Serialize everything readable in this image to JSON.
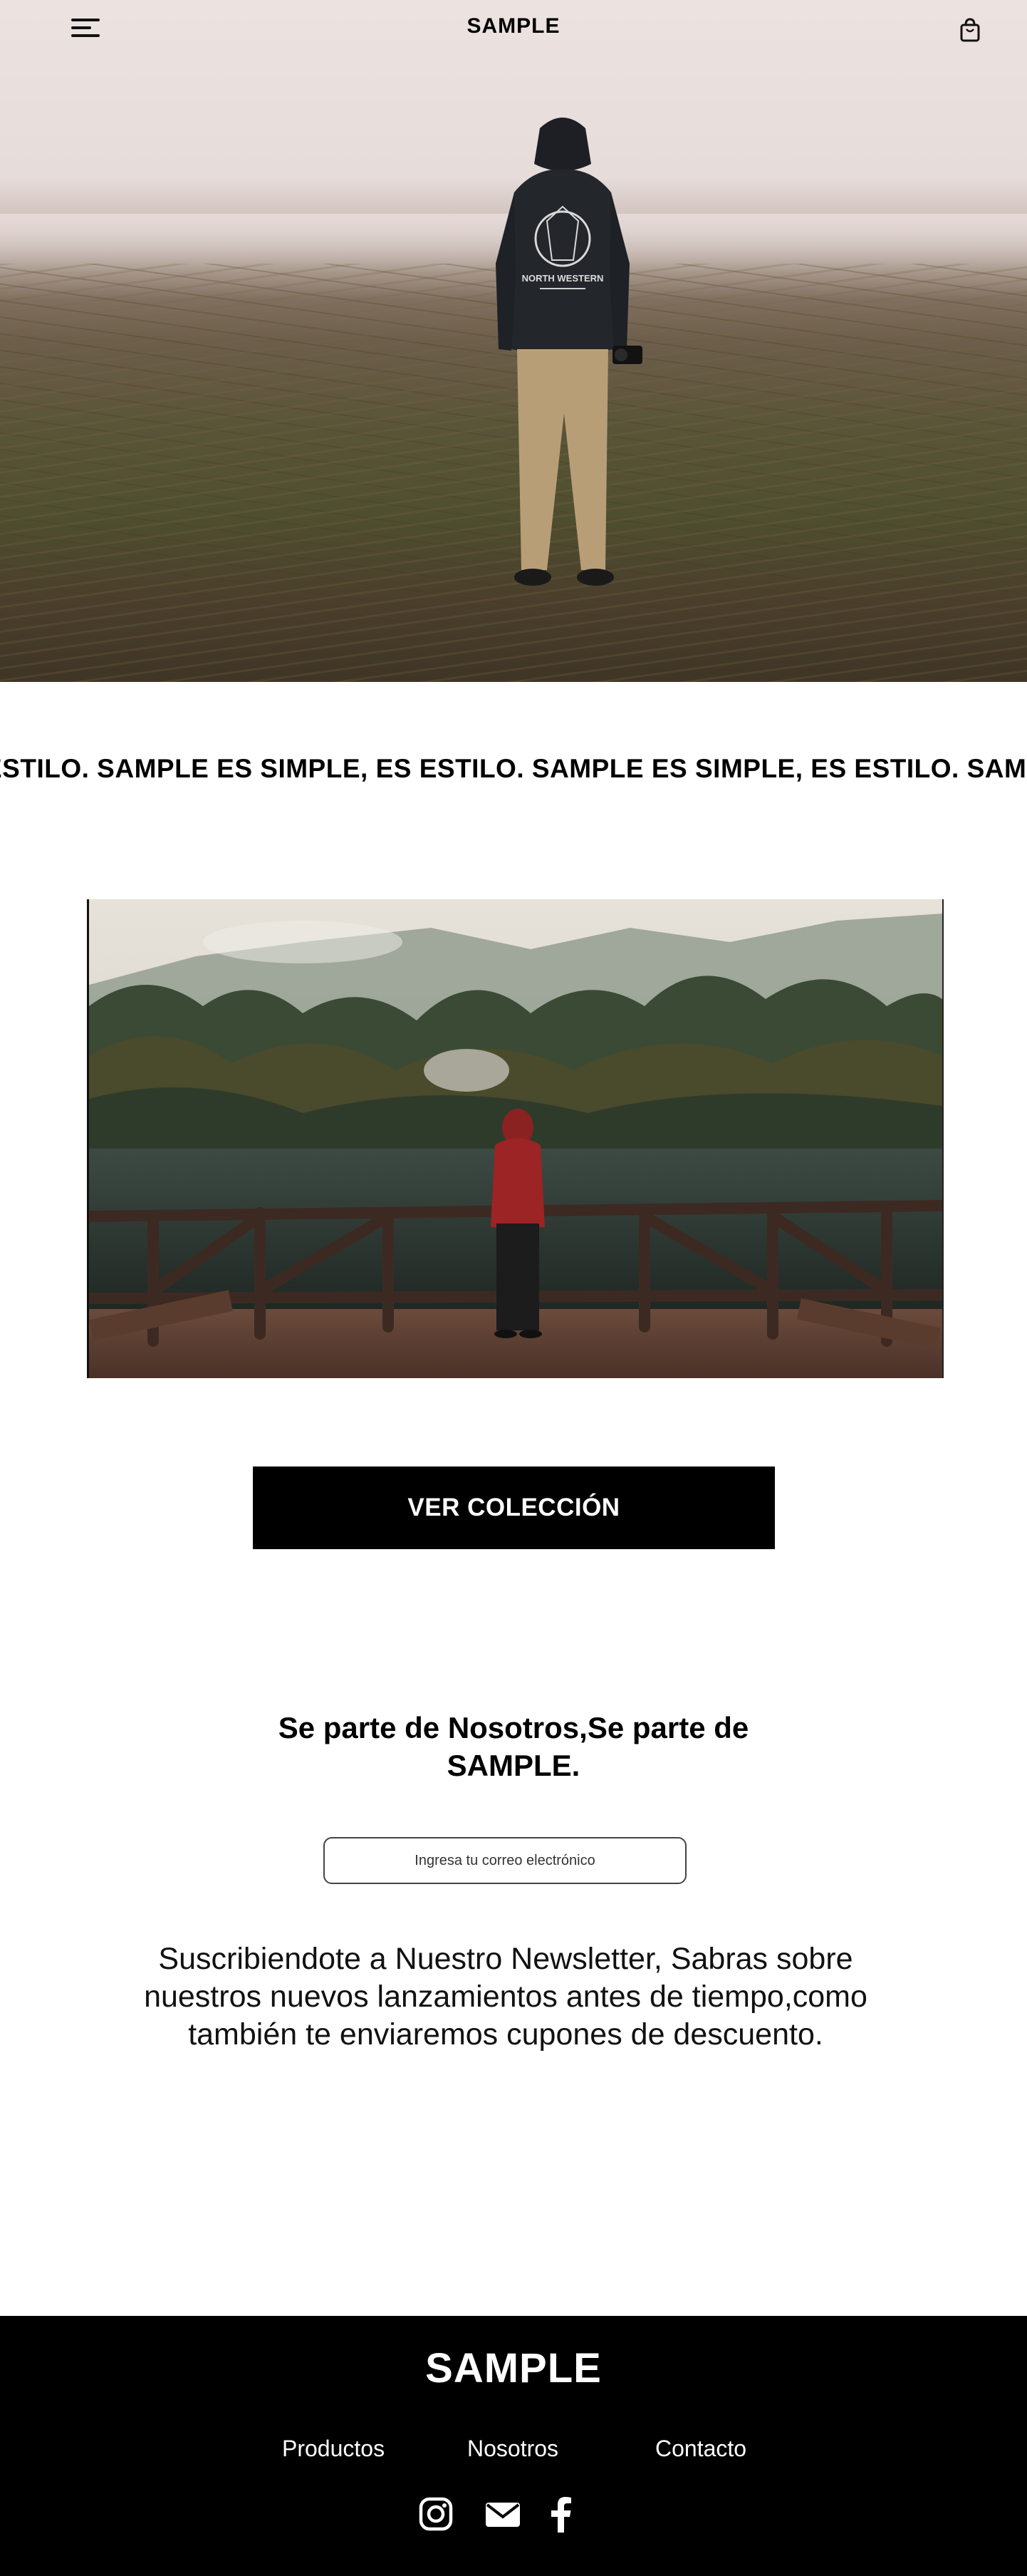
{
  "header": {
    "brand": "SAMPLE",
    "menu_icon": "hamburger-menu-icon",
    "cart_icon": "shopping-bag-icon"
  },
  "hero": {
    "hoodie_print_text": "NORTH WESTERN"
  },
  "marquee": {
    "text": "ESTILO. SAMPLE  ES SIMPLE, ES ESTILO. SAMPLE  ES SIMPLE, ES ESTILO. SAMPLE"
  },
  "cta": {
    "label": "VER COLECCIÓN"
  },
  "newsletter": {
    "title": "Se parte de Nosotros,Se parte de SAMPLE.",
    "email_placeholder": "Ingresa tu correo electrónico",
    "description": "Suscribiendote a Nuestro Newsletter, Sabras sobre nuestros nuevos lanzamientos antes de tiempo,como también te enviaremos cupones de descuento."
  },
  "footer": {
    "brand": "SAMPLE",
    "links": [
      "Productos",
      "Nosotros",
      "Contacto"
    ],
    "social_icons": [
      "instagram-icon",
      "email-icon",
      "facebook-icon"
    ]
  },
  "colors": {
    "background": "#ffffff",
    "footer_background": "#000000",
    "cta_background": "#000000",
    "cta_text": "#ffffff"
  }
}
